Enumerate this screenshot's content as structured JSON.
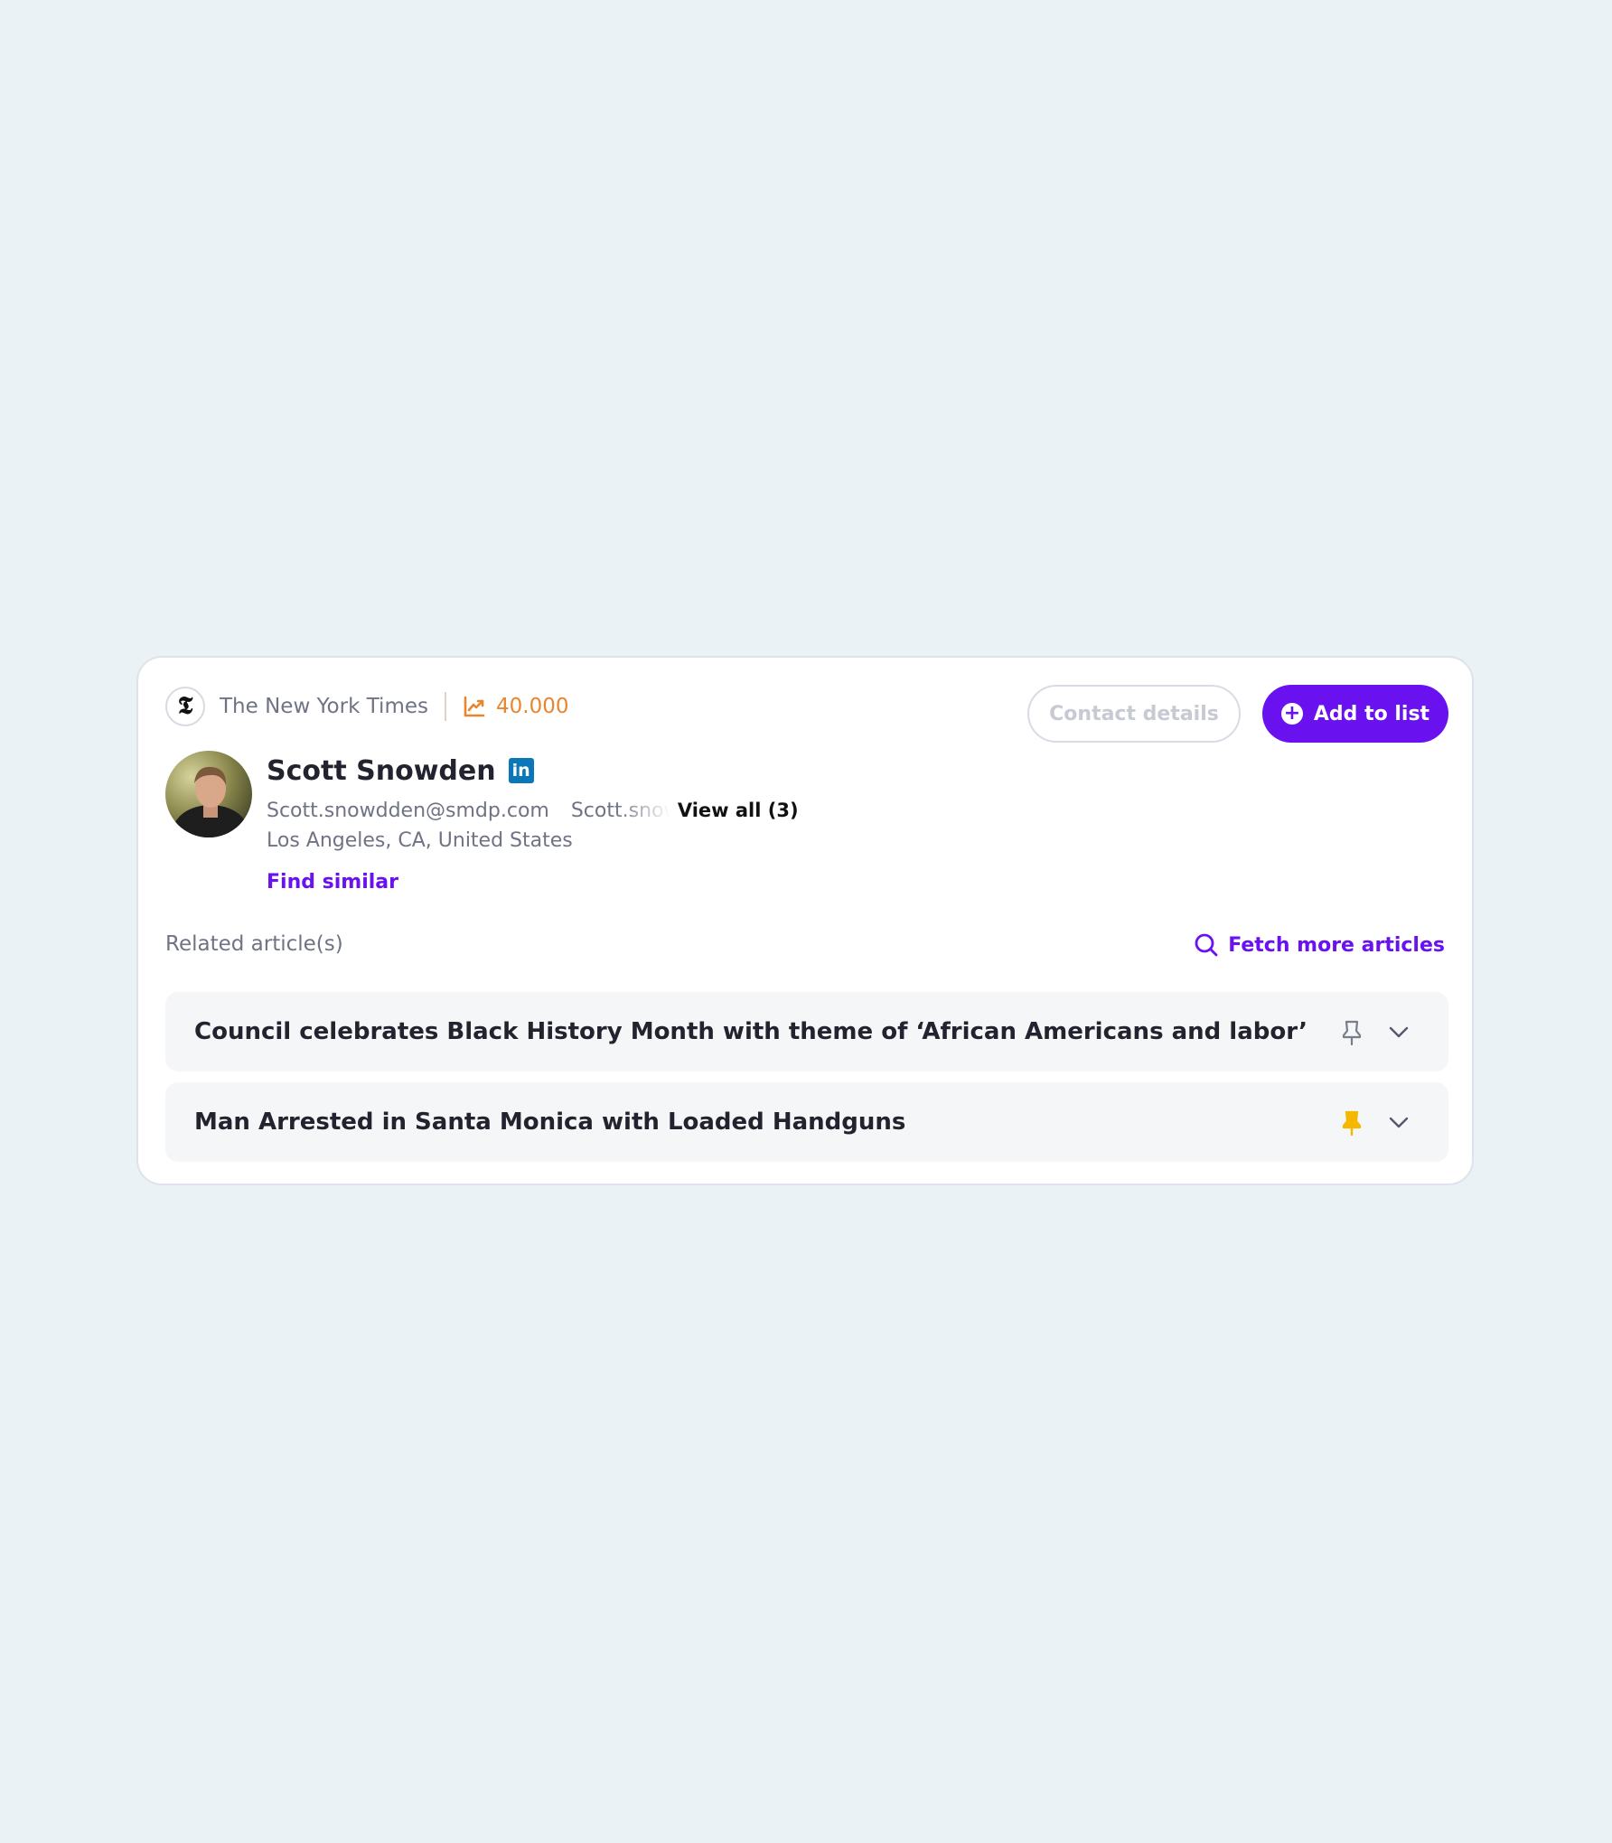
{
  "outlet": {
    "logo_glyph": "𝕿",
    "name": "The New York Times",
    "reach": "40.000",
    "reach_icon": "trend-up-icon"
  },
  "actions": {
    "contact_details_label": "Contact details",
    "add_to_list_label": "Add to list"
  },
  "contact": {
    "name": "Scott Snowden",
    "linkedin_glyph": "in",
    "email_primary": "Scott.snowdden@smdp.com",
    "email_secondary": "Scott.snowdden@smdp.com",
    "view_all_label": "View all (3)",
    "location": "Los Angeles, CA, United States",
    "find_similar_label": "Find similar"
  },
  "articles_section": {
    "label": "Related article(s)",
    "fetch_more_label": "Fetch more articles",
    "items": [
      {
        "title": "Council celebrates Black History Month with theme of ‘African Americans and labor’",
        "pinned": false
      },
      {
        "title": "Man Arrested in Santa Monica with Loaded Handguns",
        "pinned": true
      }
    ]
  },
  "colors": {
    "accent": "#6a11f0",
    "reach": "#e8862e",
    "pinned": "#f5b800",
    "unpinned": "#7a7d8a",
    "linkedin": "#0a78b8",
    "background": "#ebf2f5"
  }
}
